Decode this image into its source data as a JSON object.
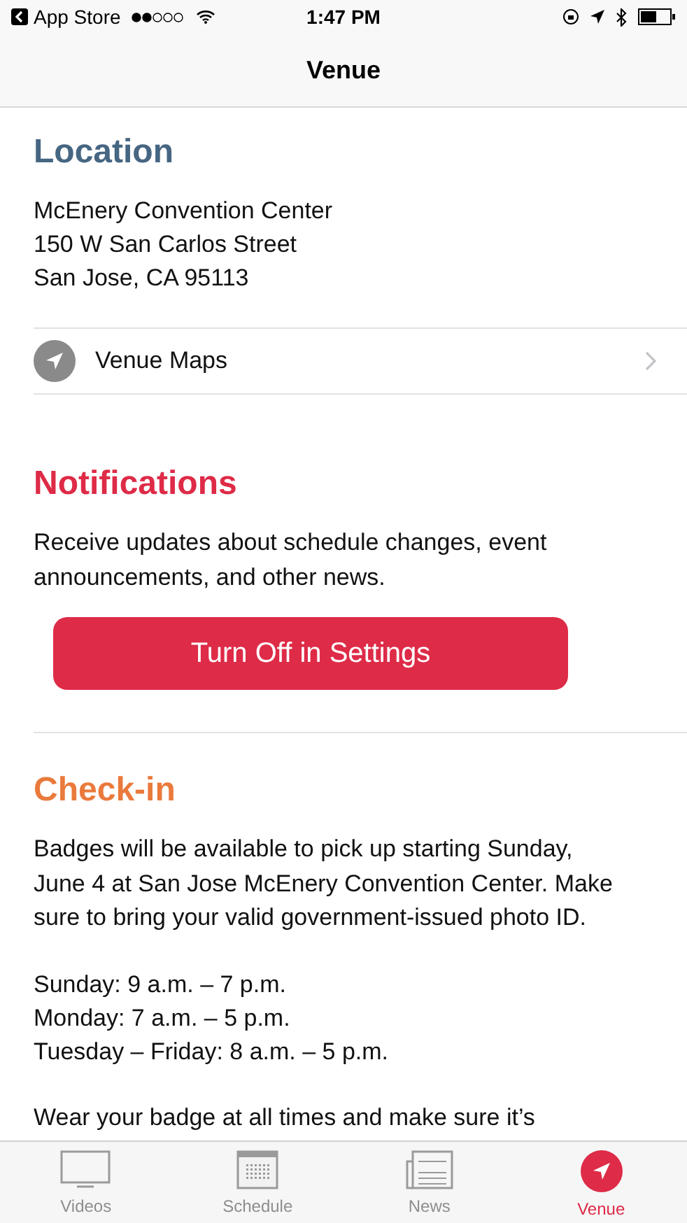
{
  "status_bar": {
    "back_label": "App Store",
    "time": "1:47 PM"
  },
  "nav": {
    "title": "Venue"
  },
  "location": {
    "heading": "Location",
    "address": [
      "McEnery Convention Center",
      "150 W San Carlos Street",
      "San Jose, CA 95113"
    ],
    "link": "Venue Maps"
  },
  "notifications": {
    "heading": "Notifications",
    "text": "Receive updates about schedule changes, event announcements, and other news.",
    "button": "Turn Off in Settings"
  },
  "checkin": {
    "heading": "Check-in",
    "paragraphs": [
      "Badges will be available to pick up starting Sunday, June 4 at San Jose McEnery Convention Center. Make sure to bring your valid government-issued photo ID."
    ],
    "hours": [
      "Sunday: 9 a.m. – 7 p.m.",
      "Monday: 7 a.m. – 5 p.m.",
      "Tuesday – Friday: 8 a.m. – 5 p.m."
    ],
    "note": "Wear your badge at all times and make sure it’s"
  },
  "tabs": [
    {
      "label": "Videos",
      "kind": "tv",
      "selected": false
    },
    {
      "label": "Schedule",
      "kind": "calendar",
      "selected": false
    },
    {
      "label": "News",
      "kind": "news",
      "selected": false
    },
    {
      "label": "Venue",
      "kind": "location",
      "selected": true
    }
  ]
}
